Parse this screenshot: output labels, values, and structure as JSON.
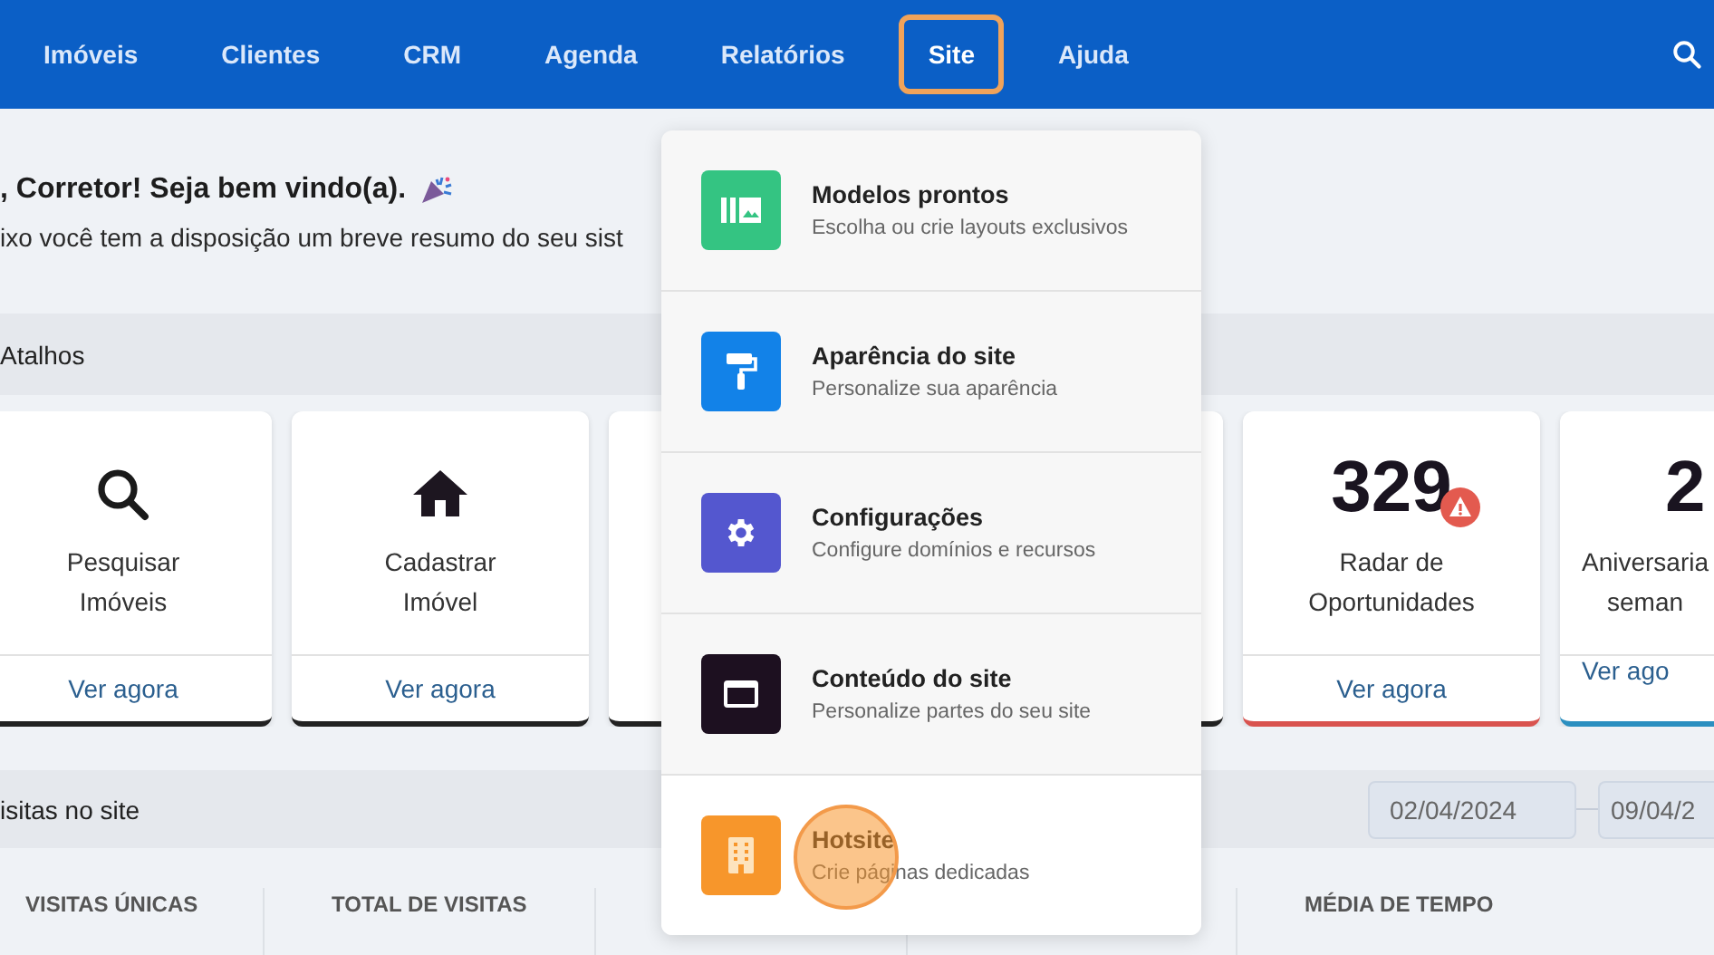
{
  "nav": {
    "items": [
      {
        "label": "Imóveis",
        "selected": false
      },
      {
        "label": "Clientes",
        "selected": false
      },
      {
        "label": "CRM",
        "selected": false
      },
      {
        "label": "Agenda",
        "selected": false
      },
      {
        "label": "Relatórios",
        "selected": false
      },
      {
        "label": "Site",
        "selected": true
      },
      {
        "label": "Ajuda",
        "selected": false
      }
    ]
  },
  "greeting": {
    "title": ", Corretor! Seja bem vindo(a).",
    "subtitle": "ixo você tem a disposição um breve resumo do seu sist"
  },
  "shortcuts": {
    "title": "Atalhos",
    "cards": [
      {
        "kind": "search",
        "label_lines": [
          "Pesquisar",
          "Imóveis"
        ],
        "link": "Ver agora",
        "color": "#222222"
      },
      {
        "kind": "house",
        "label_lines": [
          "Cadastrar",
          "Imóvel"
        ],
        "link": "Ver agora",
        "color": "#222222"
      },
      {
        "kind": "covered",
        "color": "#222222"
      },
      {
        "kind": "covered",
        "color": "#222222"
      },
      {
        "kind": "count",
        "value": "329",
        "alert": true,
        "label_lines": [
          "Radar de",
          "Oportunidades"
        ],
        "link": "Ver agora",
        "color": "#d9534f"
      },
      {
        "kind": "count",
        "value": "2",
        "label_lines": [
          "Aniversaria",
          "seman"
        ],
        "link": "Ver ago",
        "color": "#2b8fc0"
      }
    ]
  },
  "visits": {
    "title": "isitas no site",
    "dates": [
      "02/04/2024",
      "09/04/2"
    ],
    "stats": [
      {
        "kind": "metric",
        "label": "VISITAS ÚNICAS"
      },
      {
        "kind": "metric",
        "label": "TOTAL DE VISITAS"
      },
      {
        "kind": "covered"
      },
      {
        "kind": "covered"
      },
      {
        "kind": "metric",
        "label": "MÉDIA DE TEMPO"
      }
    ]
  },
  "site_menu": {
    "items": [
      {
        "kind": "gallery",
        "color": "#34c482",
        "title": "Modelos prontos",
        "subtitle": "Escolha ou crie layouts exclusivos",
        "highlighted": false
      },
      {
        "kind": "roller",
        "color": "#1282e8",
        "title": "Aparência do site",
        "subtitle": "Personalize sua aparência",
        "highlighted": false
      },
      {
        "kind": "gear",
        "color": "#5457cf",
        "title": "Configurações",
        "subtitle": "Configure domínios e recursos",
        "highlighted": false
      },
      {
        "kind": "window",
        "color": "#1d1020",
        "title": "Conteúdo do site",
        "subtitle": "Personalize partes do seu site",
        "highlighted": false
      },
      {
        "kind": "building",
        "color": "#f7962b",
        "title": "Hotsite",
        "subtitle": "Crie páginas dedicadas",
        "highlighted": true
      }
    ]
  }
}
